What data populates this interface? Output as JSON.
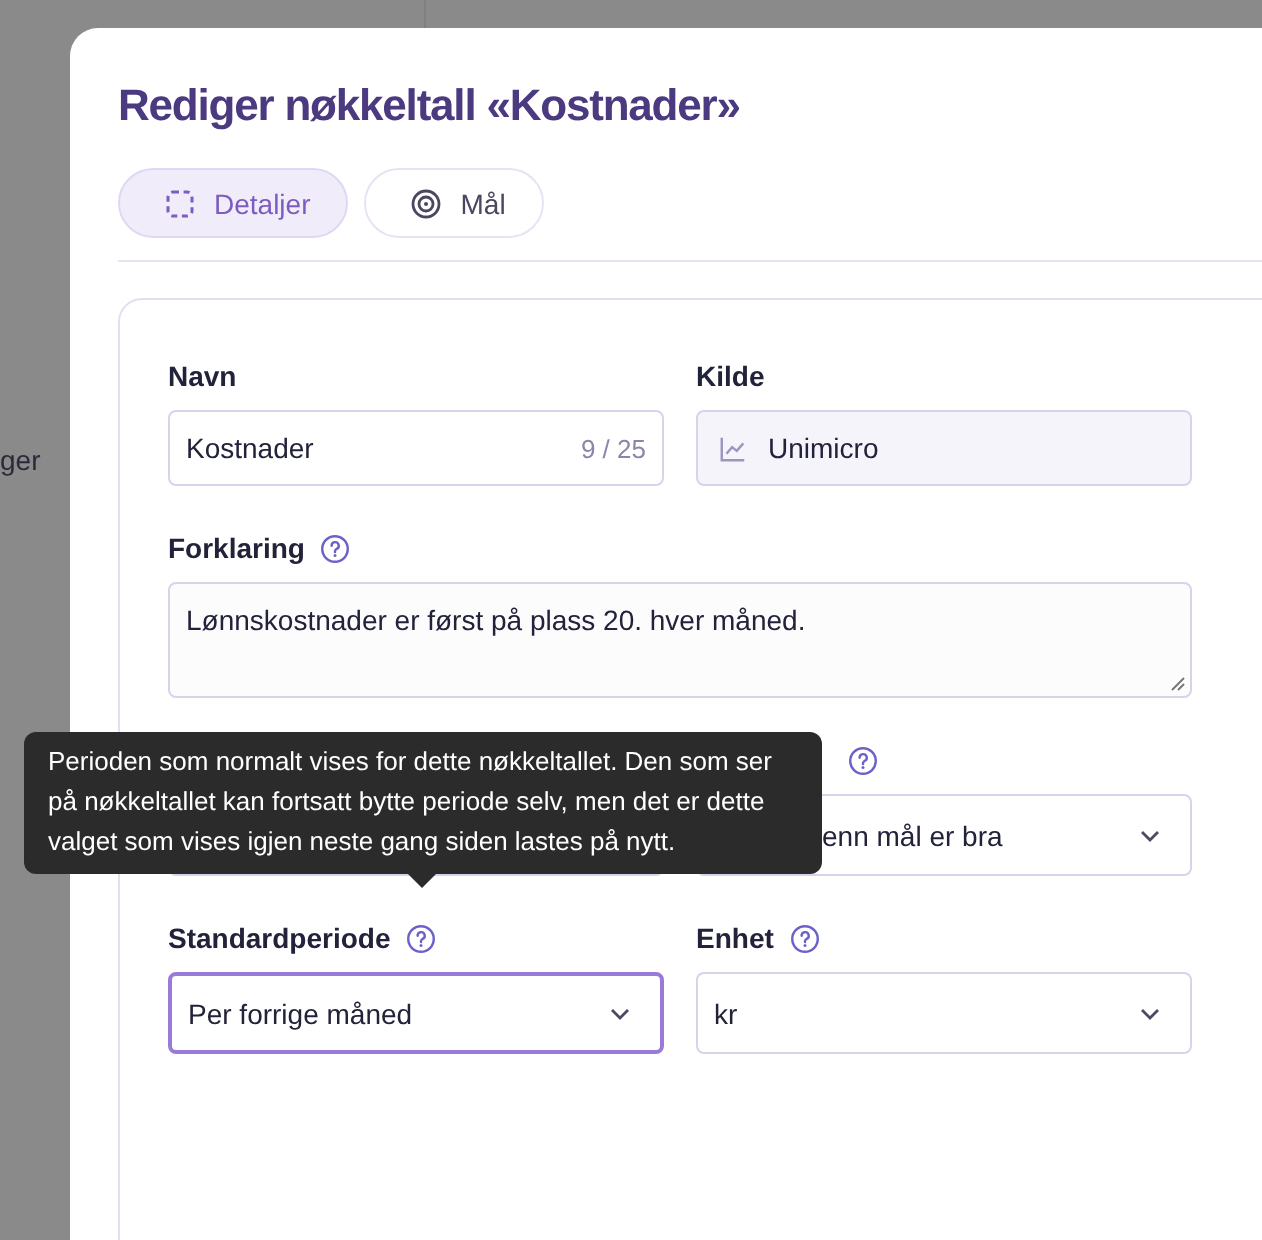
{
  "background": {
    "text": "ger"
  },
  "dialog": {
    "title": "Rediger nøkkeltall «Kostnader»",
    "tabs": [
      {
        "label": "Detaljer",
        "selected": true
      },
      {
        "label": "Mål",
        "selected": false
      }
    ],
    "fields": [
      {
        "kind": "text",
        "label": "Navn",
        "value": "Kostnader",
        "counter": "9 / 25",
        "help": false,
        "focused": false
      },
      {
        "kind": "readonly",
        "label": "Kilde",
        "value": "Unimicro",
        "help": false,
        "focused": false
      },
      {
        "kind": "textarea",
        "label": "Forklaring",
        "value": "Lønnskostnader er først på plass 20. hver måned.",
        "help": true,
        "focused": false
      },
      {
        "kind": "select",
        "focused": false
      },
      {
        "kind": "select",
        "value": "enn mål er bra",
        "help": true,
        "focused": false
      },
      {
        "kind": "select",
        "label": "Standardperiode",
        "value": "Per forrige måned",
        "help": true,
        "focused": true
      },
      {
        "kind": "select",
        "label": "Enhet",
        "value": "kr",
        "help": true,
        "focused": false
      }
    ],
    "tooltip": "Perioden som normalt vises for dette nøkkeltallet. Den som ser på nøkkeltallet kan fortsatt bytte periode selv, men det er dette valget som vises igjen neste gang siden lastes på nytt."
  }
}
